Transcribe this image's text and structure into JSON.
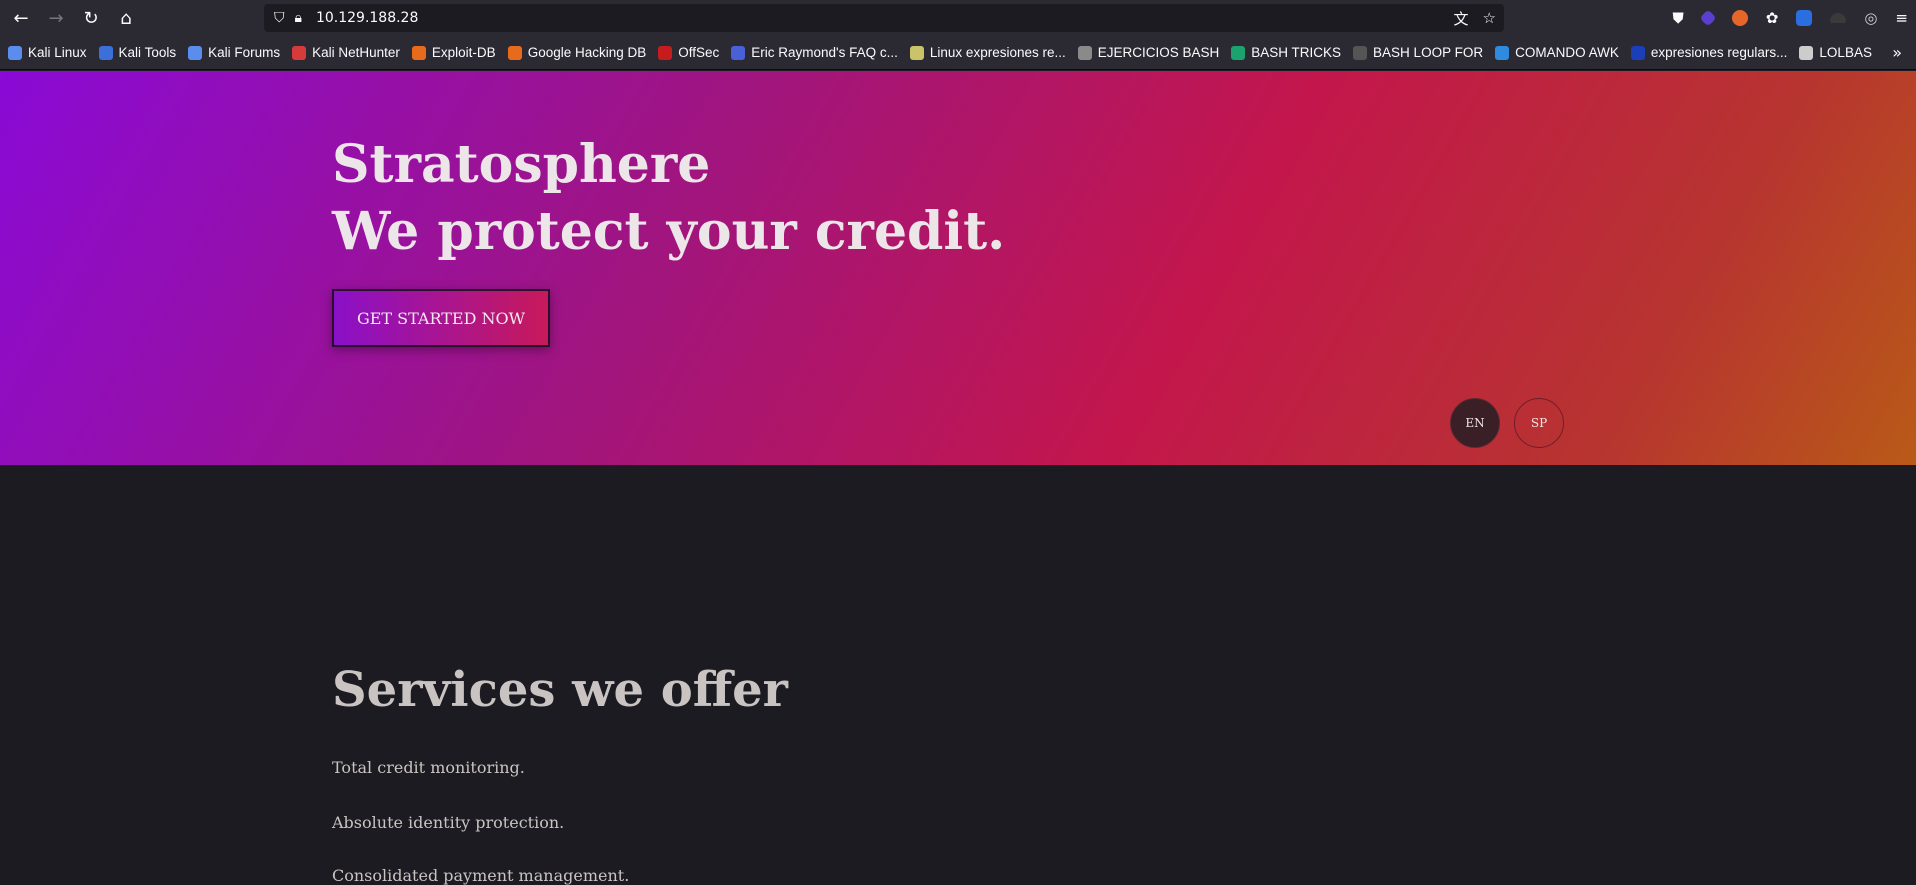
{
  "browser": {
    "url": "10.129.188.28",
    "bookmarks": [
      {
        "label": "Kali Linux",
        "color": "#5b8def"
      },
      {
        "label": "Kali Tools",
        "color": "#3d6fd8"
      },
      {
        "label": "Kali Forums",
        "color": "#5b8def"
      },
      {
        "label": "Kali NetHunter",
        "color": "#d63b3b"
      },
      {
        "label": "Exploit-DB",
        "color": "#e86a1c"
      },
      {
        "label": "Google Hacking DB",
        "color": "#e86a1c"
      },
      {
        "label": "OffSec",
        "color": "#c51d1d"
      },
      {
        "label": "Eric Raymond's FAQ c...",
        "color": "#4a60d8"
      },
      {
        "label": "Linux expresiones re...",
        "color": "#c9c36a"
      },
      {
        "label": "EJERCICIOS BASH",
        "color": "#8a8a8a"
      },
      {
        "label": "BASH TRICKS",
        "color": "#1aa36e"
      },
      {
        "label": "BASH LOOP FOR",
        "color": "#555555"
      },
      {
        "label": "COMANDO AWK",
        "color": "#2e8be0"
      },
      {
        "label": "expresiones regulars...",
        "color": "#1a3fb8"
      },
      {
        "label": "LOLBAS",
        "color": "#cccccc"
      }
    ]
  },
  "hero": {
    "title_line1": "Stratosphere",
    "title_line2": "We protect your credit.",
    "cta_label": "GET STARTED NOW",
    "lang_en": "EN",
    "lang_sp": "SP"
  },
  "services": {
    "title": "Services we offer",
    "items": [
      "Total credit monitoring.",
      "Absolute identity protection.",
      "Consolidated payment management."
    ]
  }
}
